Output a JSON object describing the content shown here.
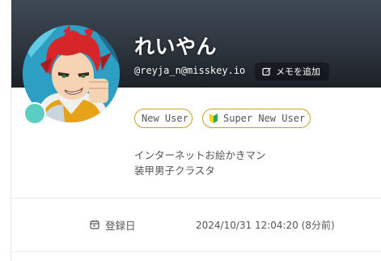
{
  "profile": {
    "display_name": "れいやん",
    "acct": "@reyja_n@misskey.io",
    "memo_button_label": "メモを追加",
    "memo_icon": "pencil-square-icon",
    "online_status_color": "#5ccdc2",
    "badges": [
      {
        "label": "New User",
        "icon": null
      },
      {
        "label": "Super New User",
        "icon": "beginner-mark-icon"
      }
    ],
    "bio_lines": [
      "インターネットお絵かきマン",
      "装甲男子クラスタ"
    ],
    "fields": [
      {
        "label": "登録日",
        "icon": "calendar-icon",
        "value": "2024/10/31 12:04:20 (8分前)"
      }
    ]
  },
  "colors": {
    "banner_dark": "#1c2128",
    "badge_border": "#c9a227",
    "text_muted": "#555555"
  }
}
